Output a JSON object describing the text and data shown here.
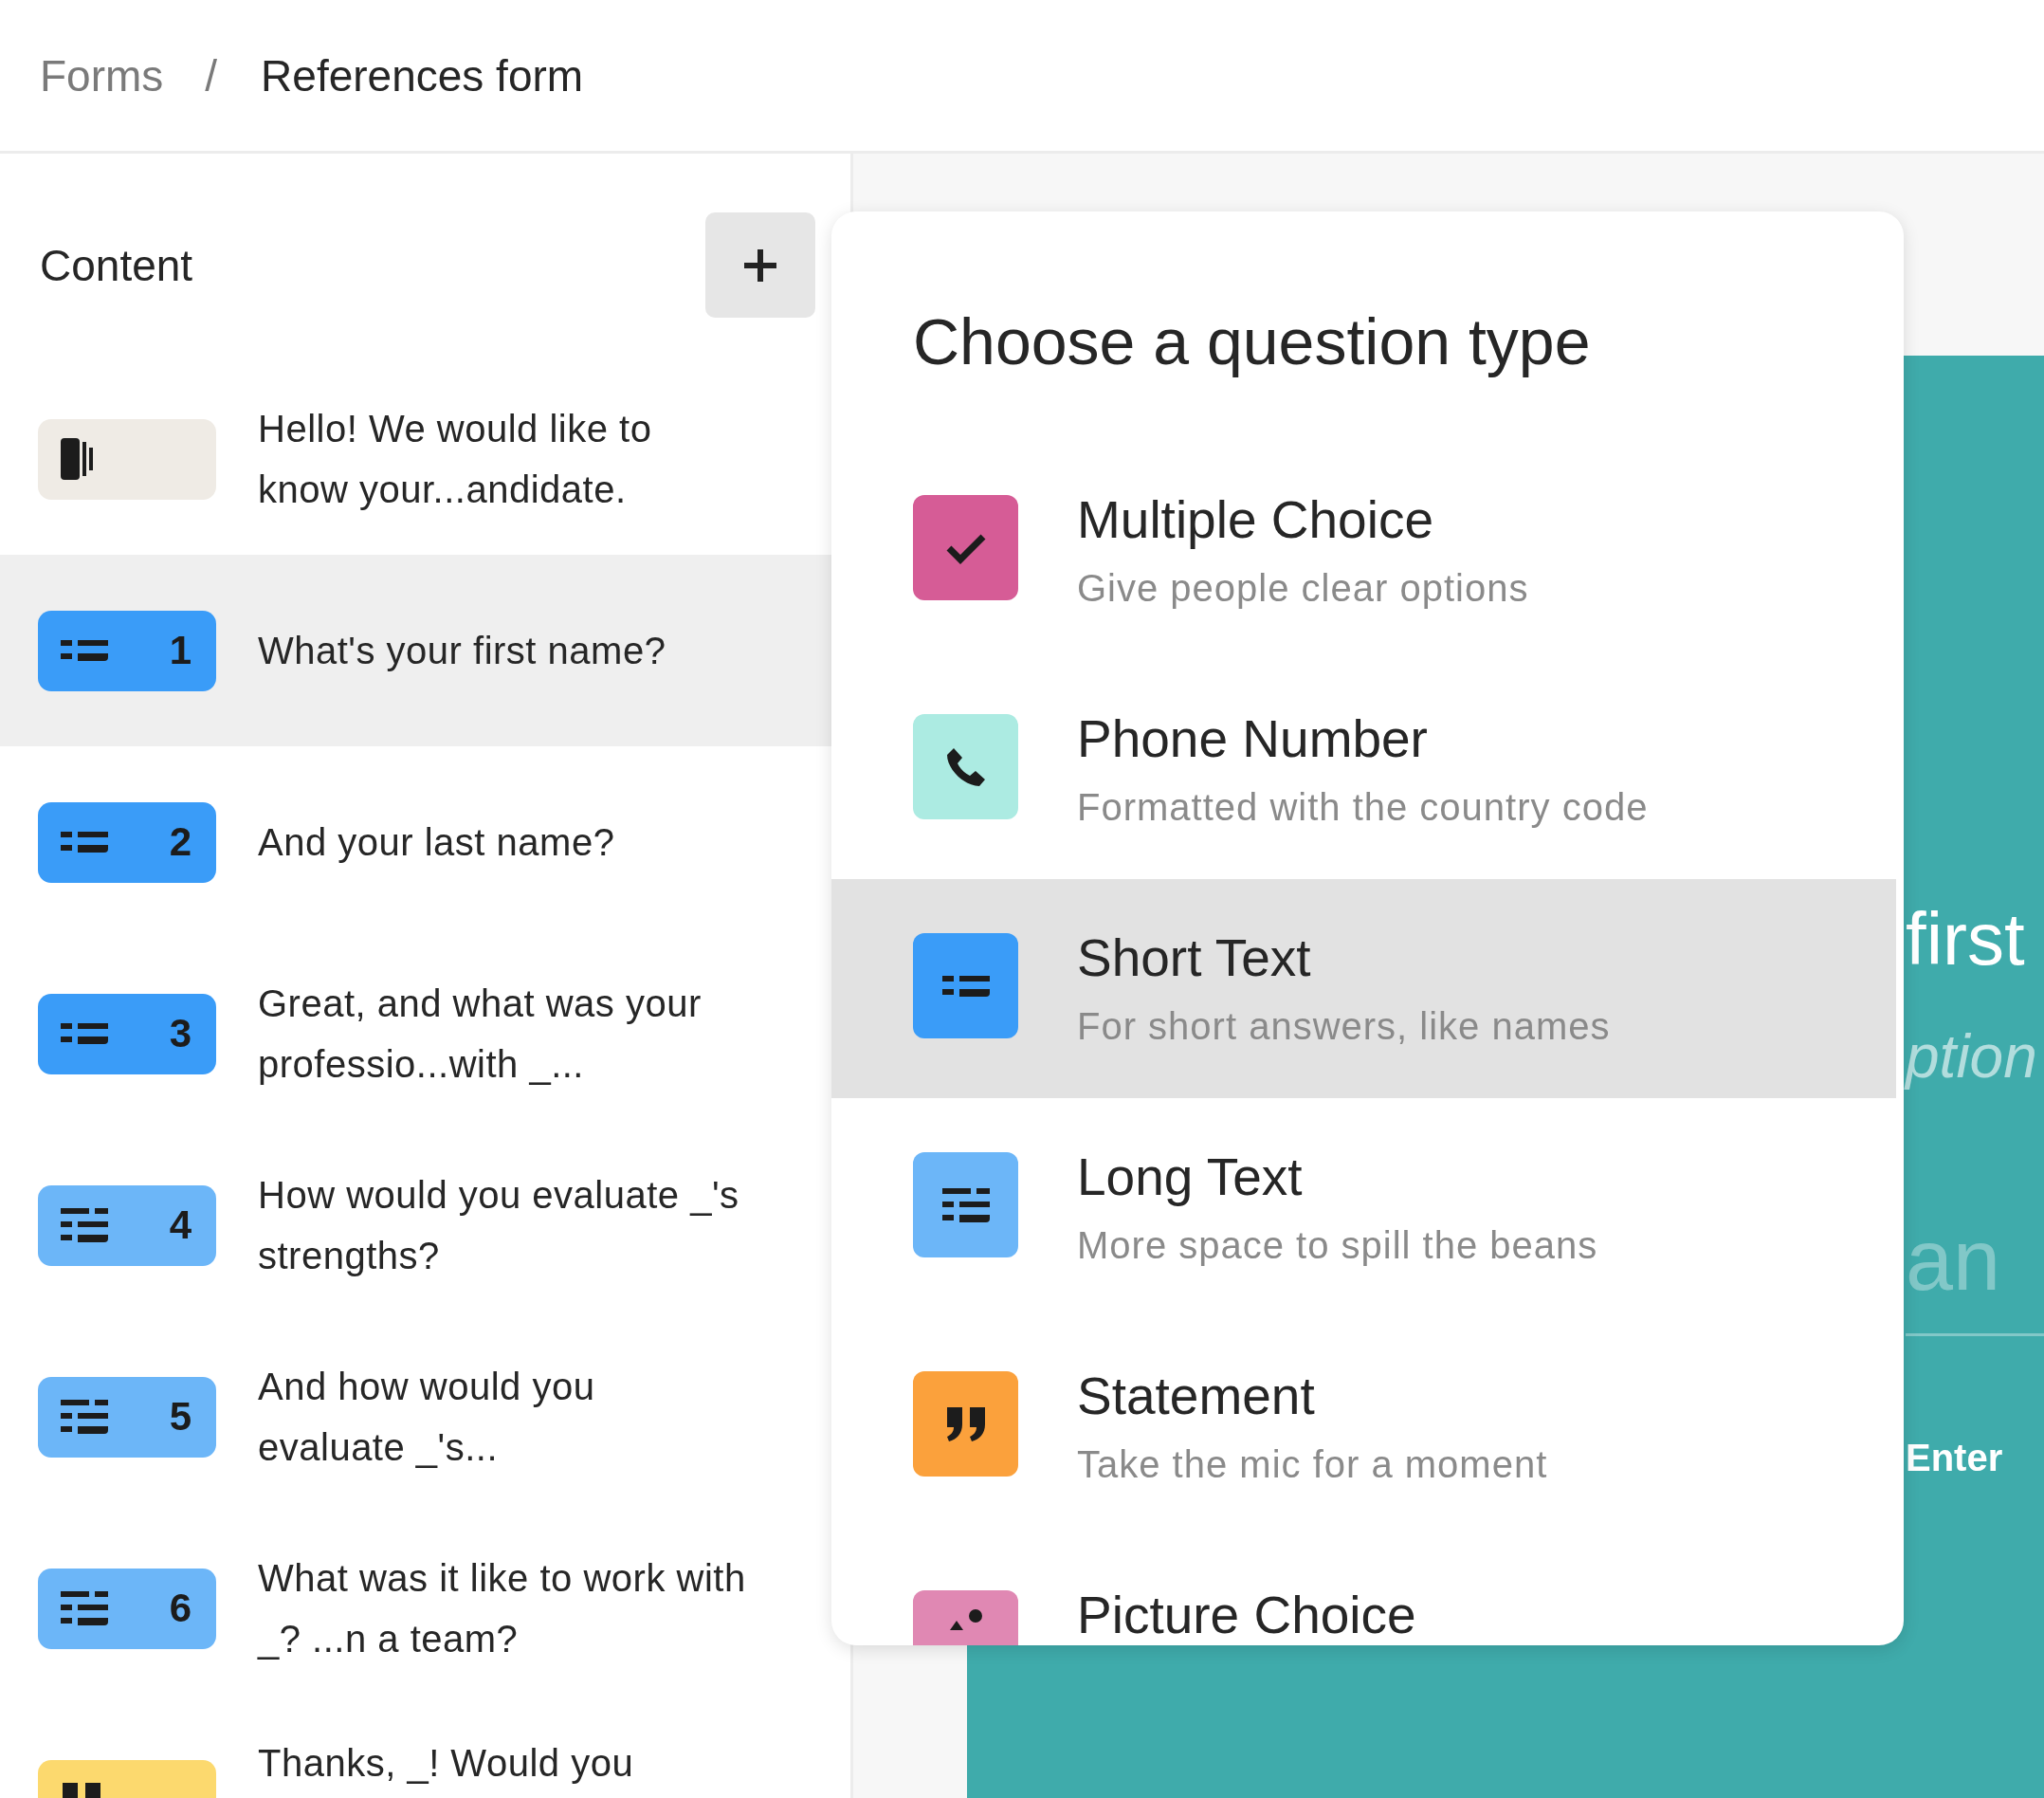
{
  "breadcrumb": {
    "parent": "Forms",
    "separator": "/",
    "current": "References form"
  },
  "sidebar": {
    "title": "Content",
    "items": [
      {
        "kind": "welcome",
        "text": "Hello! We would like to know your...andidate.",
        "selected": false
      },
      {
        "kind": "short_text",
        "number": "1",
        "text": "What's your first name?",
        "selected": true
      },
      {
        "kind": "short_text",
        "number": "2",
        "text": "And your last name?",
        "selected": false
      },
      {
        "kind": "short_text",
        "number": "3",
        "text": "Great, and what was your professio...with _...",
        "selected": false
      },
      {
        "kind": "long_text",
        "number": "4",
        "text": "How would you evaluate _'s strengths?",
        "selected": false
      },
      {
        "kind": "long_text",
        "number": "5",
        "text": "And how would you evaluate _'s...",
        "selected": false
      },
      {
        "kind": "long_text",
        "number": "6",
        "text": "What was it like to work with _? ...n a team?",
        "selected": false
      },
      {
        "kind": "statement",
        "text": "Thanks, _! Would you",
        "selected": false
      }
    ]
  },
  "preview": {
    "question": "first",
    "hint": "ption",
    "answer": "an",
    "button": "Enter"
  },
  "question_type_menu": {
    "title": "Choose a question type",
    "options": [
      {
        "kind": "multiple_choice",
        "label": "Multiple Choice",
        "description": "Give people clear options",
        "selected": false
      },
      {
        "kind": "phone_number",
        "label": "Phone Number",
        "description": "Formatted with the country code",
        "selected": false
      },
      {
        "kind": "short_text",
        "label": "Short Text",
        "description": "For short answers, like names",
        "selected": true
      },
      {
        "kind": "long_text",
        "label": "Long Text",
        "description": "More space to spill the beans",
        "selected": false
      },
      {
        "kind": "statement",
        "label": "Statement",
        "description": "Take the mic for a moment",
        "selected": false
      },
      {
        "kind": "picture_choice",
        "label": "Picture Choice",
        "selected": false
      }
    ]
  }
}
